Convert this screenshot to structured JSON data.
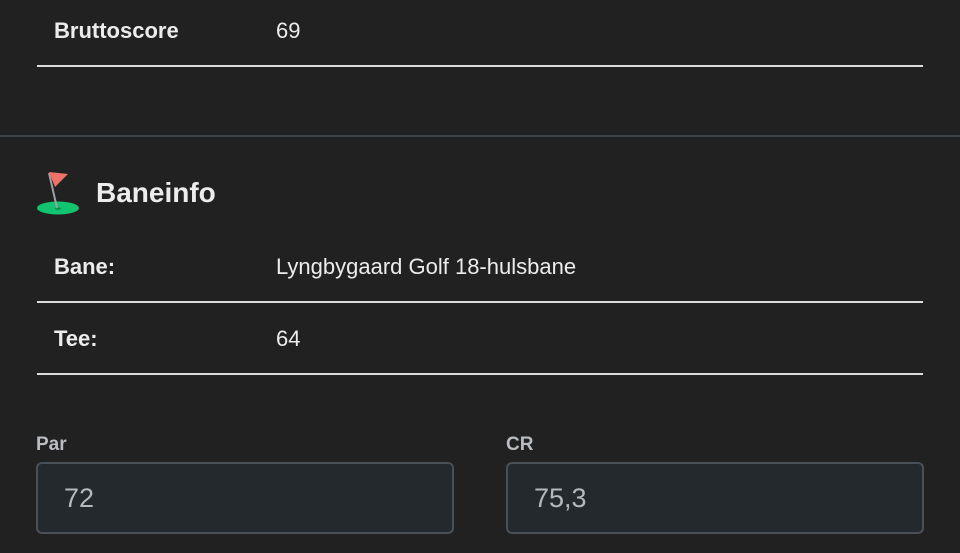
{
  "score": {
    "brutto_label": "Bruttoscore",
    "brutto_value": "69"
  },
  "course_section": {
    "title": "Baneinfo",
    "icon": "golf-flag-icon",
    "rows": [
      {
        "label": "Bane:",
        "value": "Lyngbygaard Golf 18-hulsbane"
      },
      {
        "label": "Tee:",
        "value": "64"
      }
    ]
  },
  "fields": {
    "par": {
      "label": "Par",
      "value": "72"
    },
    "cr": {
      "label": "CR",
      "value": "75,3"
    }
  },
  "colors": {
    "background": "#212121",
    "flag": "#f07167",
    "green": "#12c46f"
  }
}
